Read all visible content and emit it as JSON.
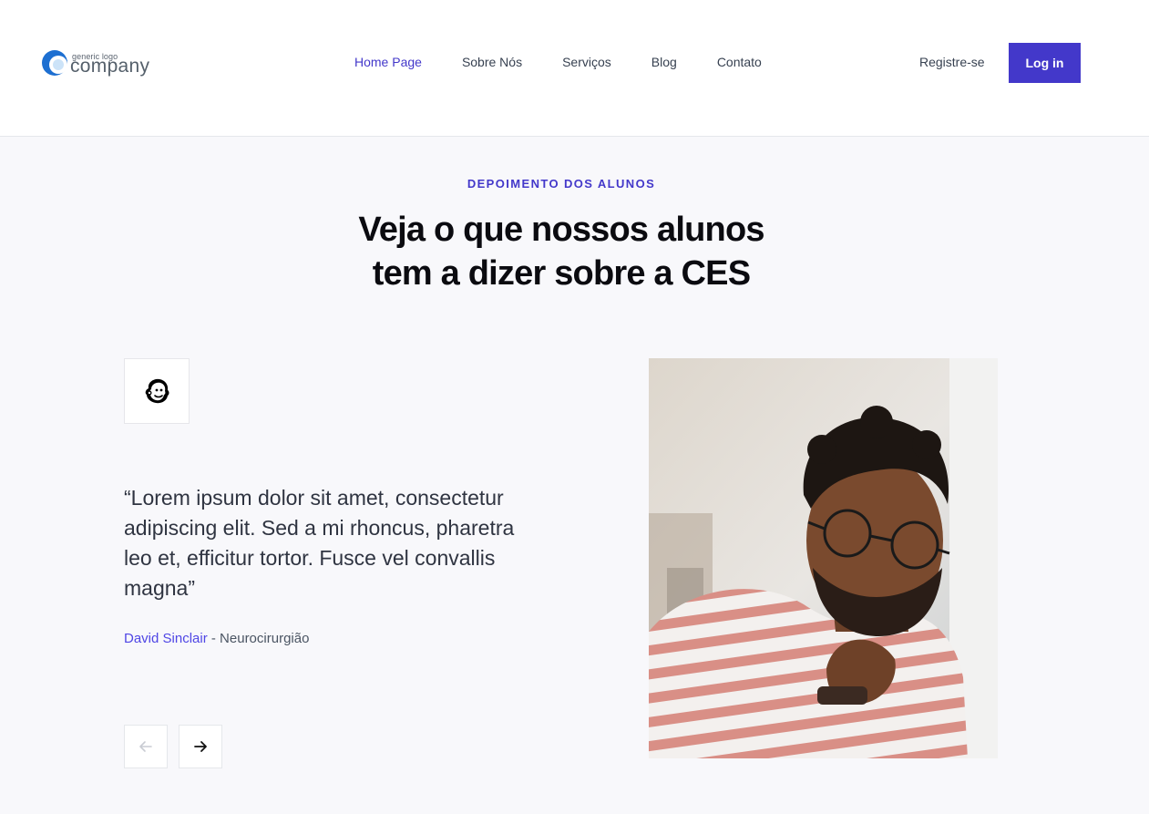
{
  "header": {
    "logo": {
      "small_text": "generic logo",
      "big_text": "company",
      "colors": {
        "blue": "#1d6fd1",
        "text": "#55606b"
      }
    },
    "nav": [
      {
        "label": "Home Page",
        "active": true
      },
      {
        "label": "Sobre Nós",
        "active": false
      },
      {
        "label": "Serviços",
        "active": false
      },
      {
        "label": "Blog",
        "active": false
      },
      {
        "label": "Contato",
        "active": false
      }
    ],
    "register_label": "Registre-se",
    "login_label": "Log in"
  },
  "testimonials": {
    "eyebrow": "DEPOIMENTO DOS ALUNOS",
    "heading_line1": "Veja o que nossos alunos",
    "heading_line2": "tem a dizer sobre a CES",
    "brand_icon": "mailchimp-icon",
    "quote": "“Lorem ipsum dolor sit amet, consectetur adipiscing elit. Sed a mi rhoncus, pharetra leo et, efficitur tortor. Fusce vel convallis magna”",
    "author_name": "David Sinclair",
    "author_separator": " - ",
    "author_role": "Neurocirurgião",
    "prev_icon": "arrow-left-icon",
    "next_icon": "arrow-right-icon",
    "photo": "student-portrait"
  },
  "colors": {
    "accent": "#4338ca",
    "background": "#f8f8fb"
  }
}
